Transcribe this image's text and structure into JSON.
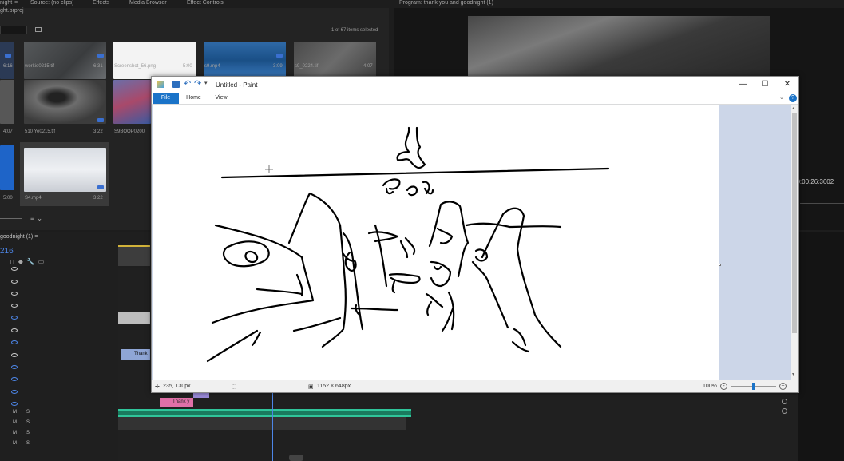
{
  "premiere": {
    "project_panel": {
      "tab_fragment": "night",
      "tabs": [
        "Source: (no clips)",
        "Effects",
        "Media Browser",
        "Effect Controls"
      ],
      "project_file": "ght.prproj",
      "items_selected": "1 of 67 items selected",
      "items": [
        {
          "name": "",
          "duration": "6:16"
        },
        {
          "name": "workio0215.tif",
          "duration": "6:31"
        },
        {
          "name": "Screenshot_56.png",
          "duration": "5:00"
        },
        {
          "name": "s9.mp4",
          "duration": "3:09"
        },
        {
          "name": "s9_0224.tif",
          "duration": "4:07"
        },
        {
          "name": "",
          "duration": "4:07"
        },
        {
          "name": "510 Ye0215.tif",
          "duration": "3:22"
        },
        {
          "name": "S9BOOP0200",
          "duration": ""
        },
        {
          "name": "",
          "duration": "5:00"
        },
        {
          "name": "S4.mp4",
          "duration": "3:22"
        }
      ]
    },
    "program_monitor": {
      "title": "Program: thank you and goodnight (1)",
      "timecode": "00:00:26:3602"
    },
    "timeline": {
      "sequence_name": "goodnight (1)",
      "playhead_time": "216",
      "clip_label_1": "Thank",
      "clip_label_2": "Thank y",
      "track_mute_label": "M",
      "track_solo_label": "S"
    },
    "colors": {
      "panel_bg": "#232323",
      "accent_blue": "#4d86e8",
      "audio_clip": "#2fc59a",
      "pink_clip": "#e070a8",
      "video_clip": "#9a8ad8"
    }
  },
  "paint": {
    "title": "Untitled - Paint",
    "tabs": {
      "file": "File",
      "home": "Home",
      "view": "View"
    },
    "window_buttons": {
      "minimize": "—",
      "maximize": "☐",
      "close": "✕"
    },
    "status": {
      "cursor_position": "235, 130px",
      "canvas_size": "1152 × 648px",
      "zoom": "100%"
    },
    "zoom_percent": 50,
    "colors": {
      "file_tab": "#1a73c8",
      "canvas_bg": "#ccd6e8"
    }
  }
}
